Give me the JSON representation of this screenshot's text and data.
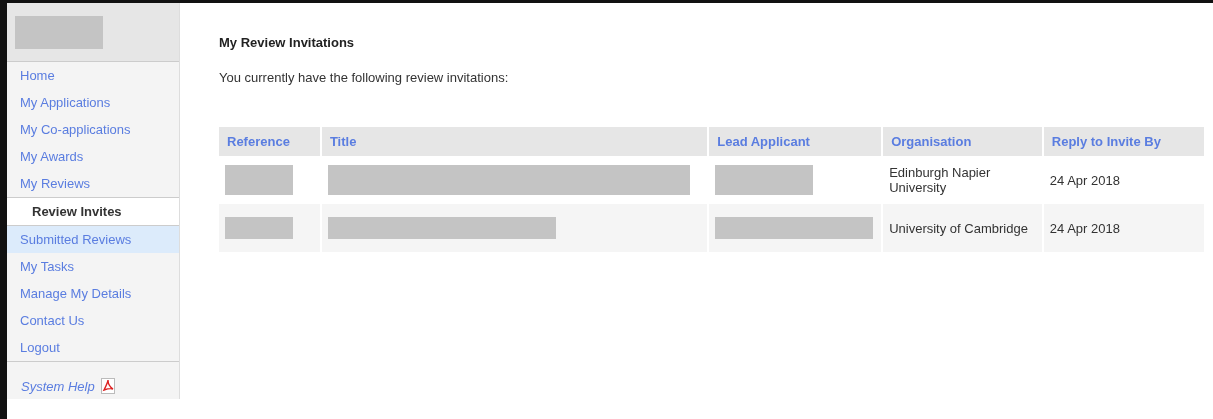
{
  "sidebar": {
    "logo": {
      "kind": "redacted"
    },
    "items": [
      {
        "label": "Home",
        "selected": false,
        "hovered": false
      },
      {
        "label": "My Applications",
        "selected": false,
        "hovered": false
      },
      {
        "label": "My Co-applications",
        "selected": false,
        "hovered": false
      },
      {
        "label": "My Awards",
        "selected": false,
        "hovered": false
      },
      {
        "label": "My Reviews",
        "selected": false,
        "hovered": false
      },
      {
        "label": "Review Invites",
        "selected": true,
        "hovered": false
      },
      {
        "label": "Submitted Reviews",
        "selected": false,
        "hovered": true
      },
      {
        "label": "My Tasks",
        "selected": false,
        "hovered": false
      },
      {
        "label": "Manage My Details",
        "selected": false,
        "hovered": false
      },
      {
        "label": "Contact Us",
        "selected": false,
        "hovered": false
      },
      {
        "label": "Logout",
        "selected": false,
        "hovered": false
      }
    ],
    "help": {
      "label": "System Help"
    }
  },
  "page": {
    "title": "My Review Invitations",
    "intro": "You currently have the following review invitations:"
  },
  "table": {
    "columns": [
      "Reference",
      "Title",
      "Lead Applicant",
      "Organisation",
      "Reply to Invite By"
    ],
    "rows": [
      {
        "cells": [
          {
            "kind": "redacted"
          },
          {
            "kind": "redacted"
          },
          {
            "kind": "redacted"
          },
          {
            "kind": "text",
            "text": "Edinburgh Napier University"
          },
          {
            "kind": "text",
            "text": "24 Apr 2018"
          }
        ]
      },
      {
        "cells": [
          {
            "kind": "redacted"
          },
          {
            "kind": "redacted"
          },
          {
            "kind": "redacted"
          },
          {
            "kind": "text",
            "text": "University of Cambridge"
          },
          {
            "kind": "text",
            "text": "24 Apr 2018"
          }
        ]
      }
    ]
  }
}
